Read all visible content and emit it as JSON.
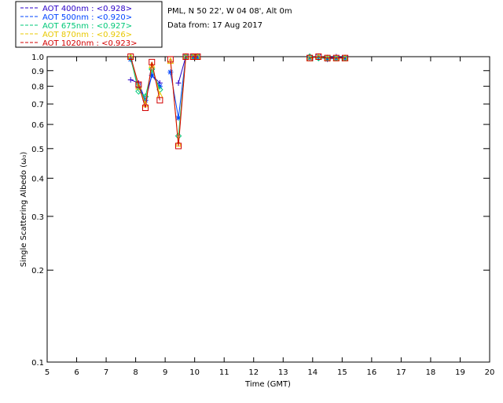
{
  "chart_data": {
    "type": "scatter",
    "title_lines": [
      "PML, N 50 22', W 04 08', Alt 0m",
      "Data from: 17 Aug 2017"
    ],
    "xlabel": "Time (GMT)",
    "ylabel": "Single Scattering Albedo (ω₀)",
    "x_range": [
      5,
      20
    ],
    "y_range": [
      0.1,
      1.0
    ],
    "y_scale": "log",
    "x_ticks": [
      5,
      6,
      7,
      8,
      9,
      10,
      11,
      12,
      13,
      14,
      15,
      16,
      17,
      18,
      19,
      20
    ],
    "x_tick_labels": [
      "5",
      "6",
      "7",
      "8",
      "9",
      "10",
      "11",
      "12",
      "13",
      "14",
      "15",
      "16",
      "17",
      "18",
      "19",
      "20"
    ],
    "y_ticks": [
      0.1,
      0.2,
      0.3,
      0.4,
      0.5,
      0.6,
      0.7,
      0.8,
      0.9,
      1.0
    ],
    "y_tick_labels": [
      "0.1",
      "0.2",
      "0.3",
      "0.4",
      "0.5",
      "0.6",
      "0.7",
      "0.8",
      "0.9",
      "1.0"
    ],
    "legend_placement": "top-left, above plot",
    "series": [
      {
        "name": "AOT  400nm : <0.928>",
        "color": "#2a00c8",
        "marker": "plus",
        "x": [
          7.83,
          8.1,
          8.33,
          8.55,
          8.82,
          9.45,
          9.7,
          9.95,
          10.1,
          13.9,
          14.2,
          14.5,
          14.8,
          15.1
        ],
        "y": [
          0.84,
          0.82,
          0.72,
          0.87,
          0.82,
          0.82,
          1.0,
          1.0,
          1.0,
          1.0,
          0.99,
          0.99,
          1.0,
          0.99
        ]
      },
      {
        "name": "AOT  500nm : <0.920>",
        "color": "#0044ff",
        "marker": "asterisk",
        "x": [
          7.83,
          8.1,
          8.33,
          8.55,
          8.82,
          9.18,
          9.45,
          9.7,
          9.95,
          10.1,
          13.9,
          14.2,
          14.5,
          14.8,
          15.1
        ],
        "y": [
          0.98,
          0.8,
          0.72,
          0.87,
          0.8,
          0.89,
          0.63,
          1.0,
          1.0,
          1.0,
          0.99,
          1.0,
          0.98,
          0.99,
          0.99
        ]
      },
      {
        "name": "AOT  675nm : <0.927>",
        "color": "#00c878",
        "marker": "diamond",
        "x": [
          7.83,
          8.1,
          8.33,
          8.55,
          8.82,
          9.45,
          9.7,
          9.95,
          10.1,
          13.9,
          14.2,
          14.5,
          14.8,
          15.1
        ],
        "y": [
          0.99,
          0.77,
          0.74,
          0.91,
          0.78,
          0.55,
          1.0,
          1.0,
          1.0,
          1.0,
          0.99,
          0.99,
          0.99,
          0.99
        ]
      },
      {
        "name": "AOT  870nm : <0.926>",
        "color": "#e8c800",
        "marker": "triangle",
        "x": [
          7.83,
          8.1,
          8.33,
          8.55,
          8.82,
          9.18,
          9.45,
          9.7,
          9.95,
          10.1,
          13.9,
          14.2,
          14.5,
          14.8,
          15.1
        ],
        "y": [
          1.0,
          0.8,
          0.7,
          0.94,
          0.75,
          0.97,
          0.52,
          1.0,
          1.0,
          1.0,
          0.99,
          1.0,
          0.99,
          0.99,
          0.99
        ]
      },
      {
        "name": "AOT 1020nm : <0.923>",
        "color": "#d20000",
        "marker": "square",
        "x": [
          7.83,
          8.1,
          8.33,
          8.55,
          8.82,
          9.18,
          9.45,
          9.7,
          9.95,
          10.1,
          13.9,
          14.2,
          14.5,
          14.8,
          15.1
        ],
        "y": [
          1.0,
          0.81,
          0.68,
          0.96,
          0.72,
          0.98,
          0.51,
          1.0,
          1.0,
          1.0,
          0.99,
          1.0,
          0.99,
          0.99,
          0.99
        ]
      }
    ]
  }
}
